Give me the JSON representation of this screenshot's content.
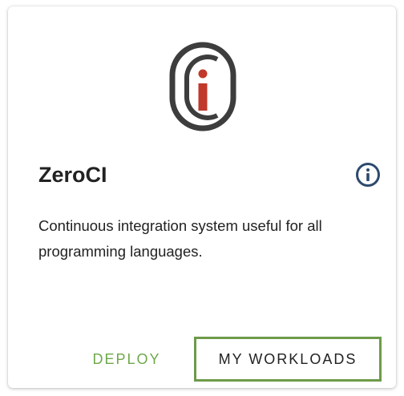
{
  "card": {
    "logo_icon": "zeroci-logo-icon",
    "title": "ZeroCI",
    "description": "Continuous integration system useful for all programming languages.",
    "info_icon": "info-circle-icon"
  },
  "actions": {
    "deploy_label": "DEPLOY",
    "workloads_label": "MY WORKLOADS"
  },
  "colors": {
    "deploy_text": "#6ea84a",
    "workloads_text": "#222222",
    "workloads_border": "#6e9a4a",
    "info_icon": "#2d4a6e",
    "logo_ring": "#3d3d3d",
    "logo_letter": "#c0392b"
  }
}
